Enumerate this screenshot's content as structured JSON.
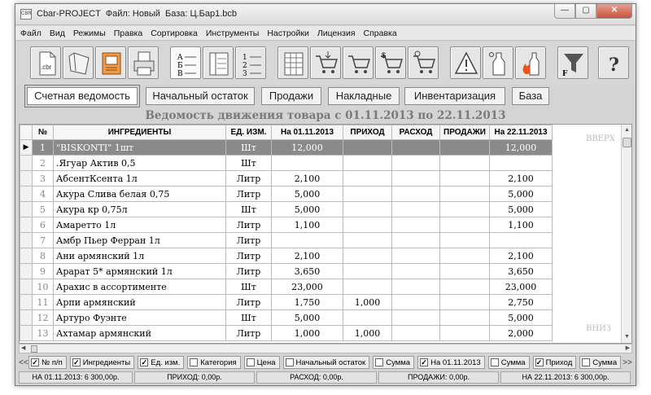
{
  "window": {
    "title": "Cbar-PROJECT  Файл: Новый  База: Ц.Бар1.bcb",
    "minimize_glyph": "—",
    "maximize_glyph": "▢",
    "close_glyph": "✕"
  },
  "menu": [
    "Файл",
    "Вид",
    "Режимы",
    "Правка",
    "Сортировка",
    "Инструменты",
    "Настройки",
    "Лицензия",
    "Справка"
  ],
  "toolbar": {
    "icons": [
      "open-cbr-icon",
      "folder-icon",
      "save-icon",
      "print-icon",
      "sort-alpha-icon",
      "sort-list-icon",
      "sort-numeric-icon",
      "table-grid-icon",
      "cart-in-icon",
      "cart-out-icon",
      "cart-money-icon",
      "cart-settings-icon",
      "warning-icon",
      "bottles-icon",
      "fire-bottle-icon",
      "filter-icon",
      "help-icon"
    ],
    "cbr_label": ".cbr",
    "filter_label": "F",
    "help_label": "?"
  },
  "sections": [
    "Счетная ведомость",
    "Начальный остаток",
    "Продажи",
    "Накладные",
    "Инвентаризация",
    "База"
  ],
  "report_title": "Ведомость движения товара с 01.11.2013 по 22.11.2013",
  "grid": {
    "headers": [
      "№",
      "ИНГРЕДИЕНТЫ",
      "ЕД. ИЗМ.",
      "На 01.11.2013",
      "ПРИХОД",
      "РАСХОД",
      "ПРОДАЖИ",
      "На 22.11.2013"
    ],
    "up_label": "ВВЕРХ",
    "down_label": "ВНИЗ",
    "row_marker": "▶",
    "rows": [
      [
        "1",
        "\"BISKONTI\" 1шт",
        "Шт",
        "12,000",
        "",
        "",
        "",
        "12,000"
      ],
      [
        "2",
        ".Ягуар Актив 0,5",
        "Шт",
        "",
        "",
        "",
        "",
        ""
      ],
      [
        "3",
        "АбсентКсента 1л",
        "Литр",
        "2,100",
        "",
        "",
        "",
        "2,100"
      ],
      [
        "4",
        "Акура Слива белая 0,75",
        "Литр",
        "5,000",
        "",
        "",
        "",
        "5,000"
      ],
      [
        "5",
        "Акура кр 0,75л",
        "Шт",
        "5,000",
        "",
        "",
        "",
        "5,000"
      ],
      [
        "6",
        "Амаретто 1л",
        "Литр",
        "1,100",
        "",
        "",
        "",
        "1,100"
      ],
      [
        "7",
        "Амбр Пьер Ферран 1л",
        "Литр",
        "",
        "",
        "",
        "",
        ""
      ],
      [
        "8",
        "Ани армянский 1л",
        "Литр",
        "2,100",
        "",
        "",
        "",
        "2,100"
      ],
      [
        "9",
        "Арарат 5* армянский 1л",
        "Литр",
        "3,650",
        "",
        "",
        "",
        "3,650"
      ],
      [
        "10",
        "Арахис в ассортименте",
        "Шт",
        "23,000",
        "",
        "",
        "",
        "23,000"
      ],
      [
        "11",
        "Арпи армянский",
        "Литр",
        "1,750",
        "1,000",
        "",
        "",
        "2,750"
      ],
      [
        "12",
        "Артуро Фуэнте",
        "Шт",
        "5,000",
        "",
        "",
        "",
        "5,000"
      ],
      [
        "13",
        "Ахтамар армянский",
        "Литр",
        "1,000",
        "1,000",
        "",
        "",
        "2,000"
      ]
    ]
  },
  "column_toggles": {
    "prev": "<<",
    "next": ">>",
    "items": [
      {
        "label": "№ п/п",
        "checked": true
      },
      {
        "label": "Ингредиенты",
        "checked": true
      },
      {
        "label": "Ед. изм.",
        "checked": true
      },
      {
        "label": "Категория",
        "checked": false
      },
      {
        "label": "Цена",
        "checked": false
      },
      {
        "label": "Начальный остаток",
        "checked": false
      },
      {
        "label": "Сумма",
        "checked": false
      },
      {
        "label": "На 01.11.2013",
        "checked": true
      },
      {
        "label": "Сумма",
        "checked": false
      },
      {
        "label": "Приход",
        "checked": true
      },
      {
        "label": "Сумма",
        "checked": false
      },
      {
        "label": "Ра",
        "checked": true
      }
    ]
  },
  "status": [
    "НА 01.11.2013:  6 300,00р.",
    "ПРИХОД: 0,00р.",
    "РАСХОД: 0,00р.",
    "ПРОДАЖИ: 0,00р.",
    "НА 22.11.2013:  6 300,00р."
  ]
}
